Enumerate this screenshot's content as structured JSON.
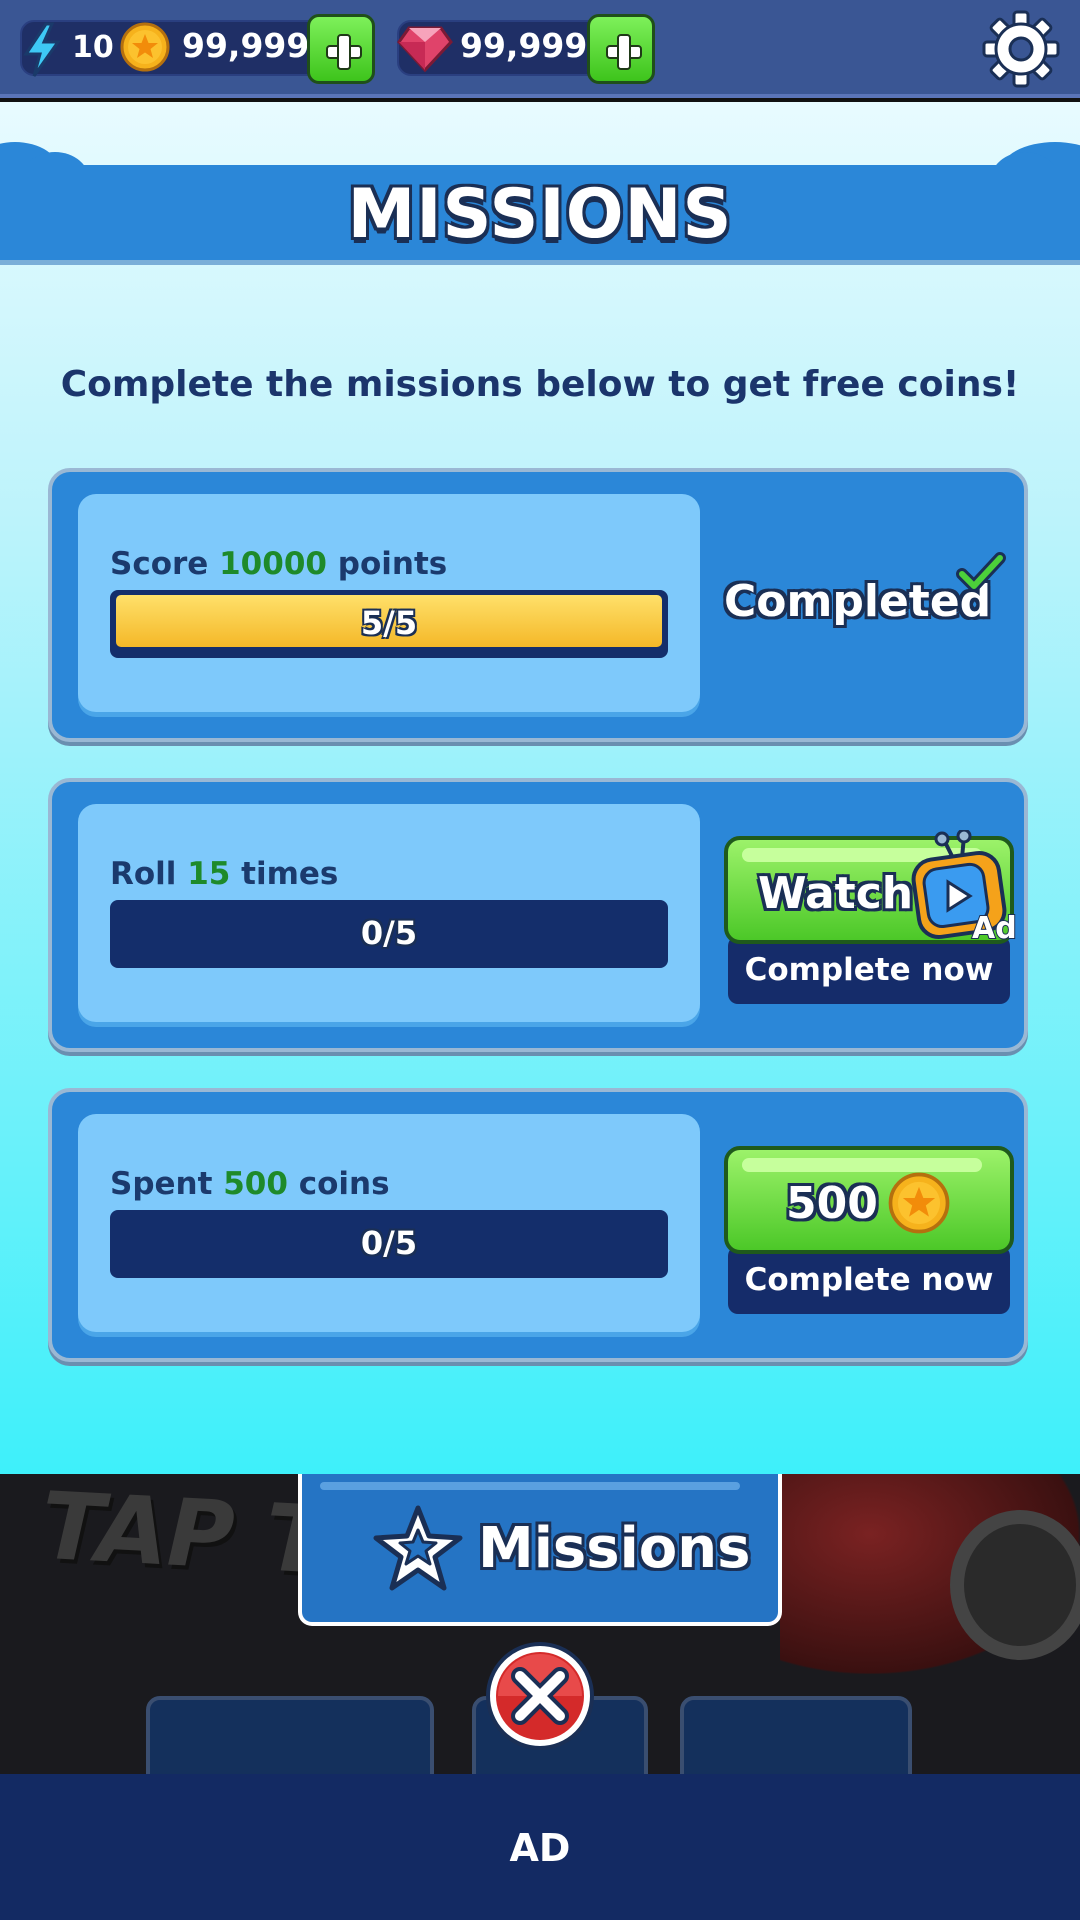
{
  "currencies": {
    "energy": "10",
    "coins": "99,999",
    "gems": "99,999"
  },
  "title": "MISSIONS",
  "subtitle": "Complete the missions below to get free coins!",
  "missions": [
    {
      "prefix": "Score ",
      "amount": "10000",
      "suffix": " points",
      "progress_text": "5/5",
      "progress": 1.0,
      "status": "Completed"
    },
    {
      "prefix": "Roll ",
      "amount": "15",
      "suffix": " times",
      "progress_text": "0/5",
      "progress": 0,
      "button_label": "Watch",
      "button_badge": "Ad",
      "action_label": "Complete now"
    },
    {
      "prefix": "Spent ",
      "amount": "500",
      "suffix": " coins",
      "progress_text": "0/5",
      "progress": 0,
      "button_label": "500",
      "action_label": "Complete now"
    }
  ],
  "background": {
    "tap_text": "TAP T",
    "tab_label": "Missions"
  },
  "ad_banner": "AD",
  "colors": {
    "header_blue": "#2b87d8",
    "card_inner": "#7ec9fb",
    "progress_track": "#142e6b",
    "progress_fill": "#f4b828",
    "highlight_green": "#1e8a2a",
    "button_green": "#4cc828",
    "ad_bar": "#132a63"
  }
}
